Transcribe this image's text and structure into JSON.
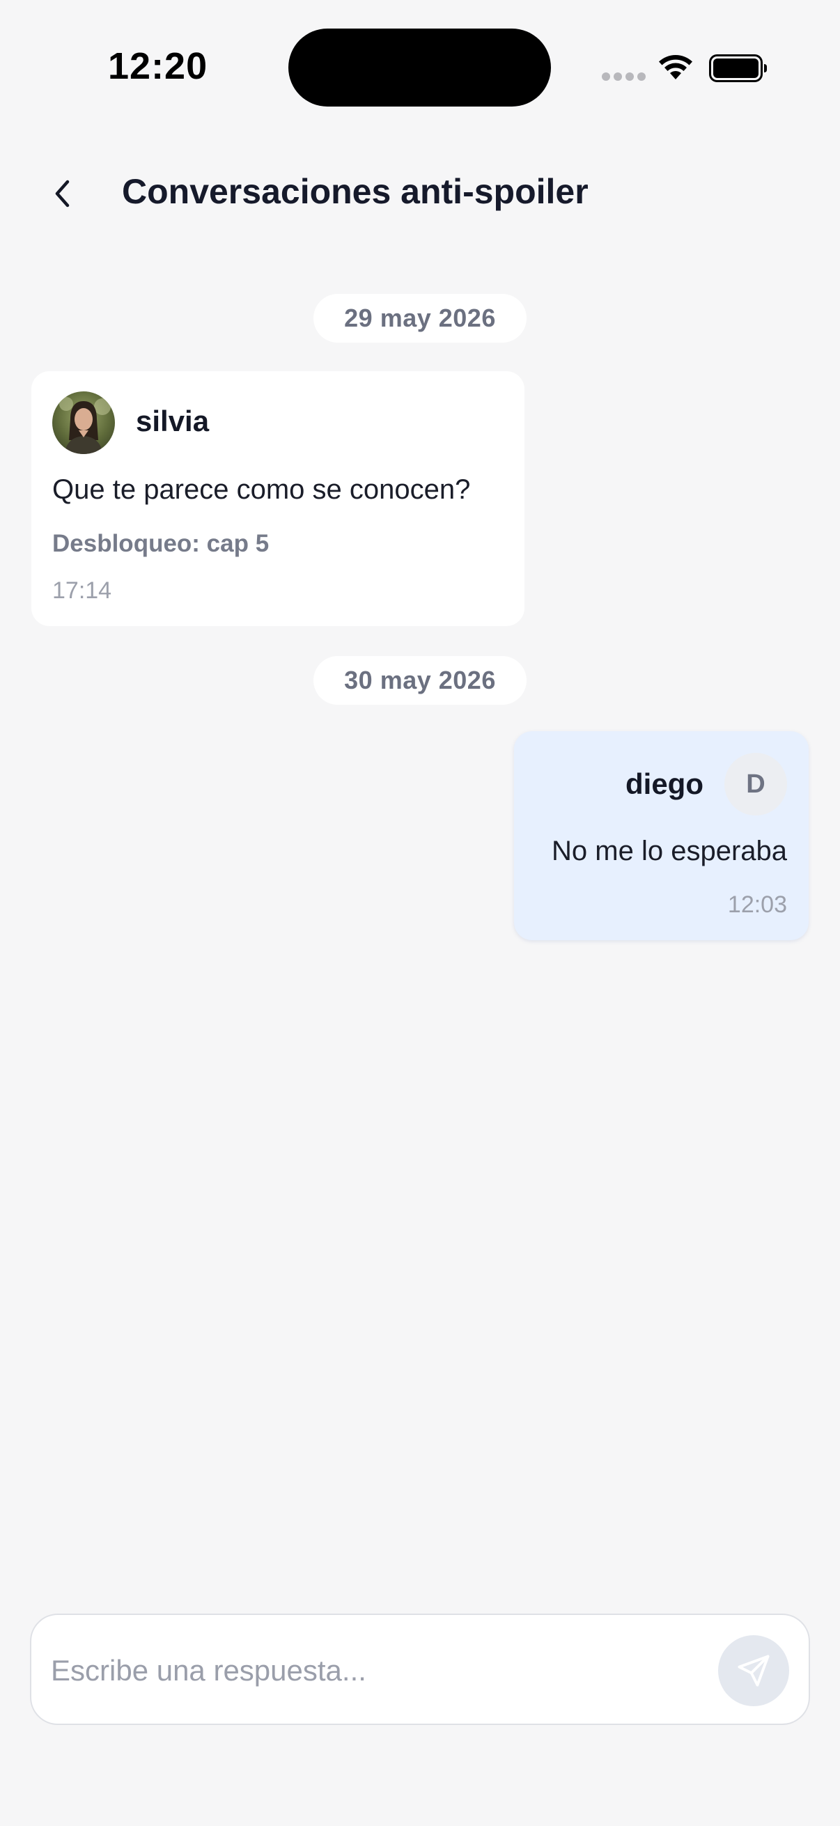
{
  "status_bar": {
    "time": "12:20",
    "icons": [
      "cellular-signal-icon",
      "wifi-icon",
      "battery-icon"
    ]
  },
  "header": {
    "back_icon": "chevron-left-icon",
    "title": "Conversaciones anti-spoiler"
  },
  "thread": {
    "groups": [
      {
        "date": "29 may 2026",
        "message": {
          "sender": "silvia",
          "avatar": "profile-photo",
          "text": "Que te parece como se conocen?",
          "unlock": "Desbloqueo: cap 5",
          "time": "17:14"
        }
      },
      {
        "date": "30 may 2026",
        "message": {
          "sender": "diego",
          "avatar_initial": "D",
          "text": "No me lo esperaba",
          "time": "12:03"
        }
      }
    ]
  },
  "composer": {
    "placeholder": "Escribe una respuesta...",
    "value": "",
    "send_icon": "paper-plane-icon"
  },
  "colors": {
    "background": "#f6f6f7",
    "outgoing_bubble": "#e7f0fe",
    "incoming_bubble": "#ffffff",
    "send_button_disabled": "#e4e8ef"
  }
}
